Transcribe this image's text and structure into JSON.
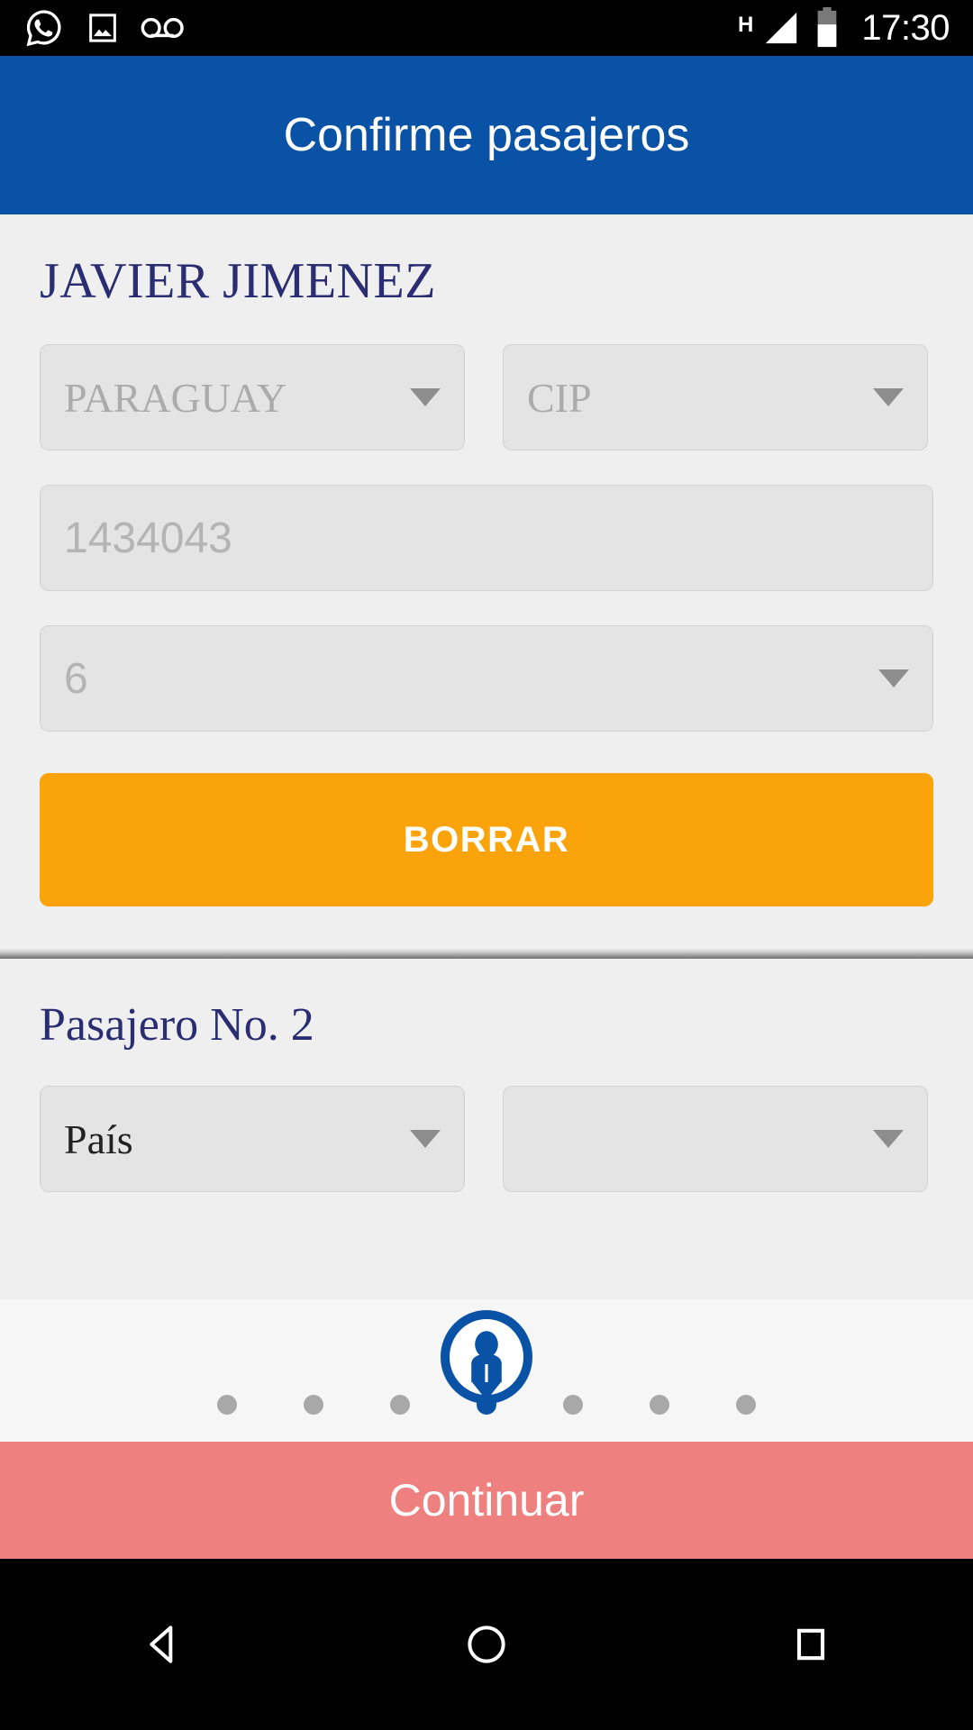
{
  "statusbar": {
    "icons": [
      "whatsapp-icon",
      "photo-icon",
      "voicemail-icon"
    ],
    "network_label": "H",
    "signal_icon": "signal-triangle-icon",
    "battery_icon": "battery-icon",
    "clock": "17:30"
  },
  "header": {
    "title": "Confirme pasajeros",
    "color": "#0A52A6"
  },
  "passenger1": {
    "name": "JAVIER JIMENEZ",
    "country": "PARAGUAY",
    "doc_type": "CIP",
    "doc_number": "1434043",
    "seat": "6",
    "delete_label": "BORRAR",
    "delete_color": "#FBA30A"
  },
  "passenger2": {
    "heading": "Pasajero No. 2",
    "country": "País",
    "doc_type": ""
  },
  "stepper": {
    "icon": "person-pin-icon",
    "total_steps": 7,
    "active_step": 4,
    "active_color": "#0A52A6",
    "inactive_color": "#a8a8a8"
  },
  "footer": {
    "continue_label": "Continuar",
    "continue_color": "#EE8080"
  },
  "navbar": {
    "back": "back-triangle-icon",
    "home": "home-circle-icon",
    "recents": "recents-square-icon"
  }
}
